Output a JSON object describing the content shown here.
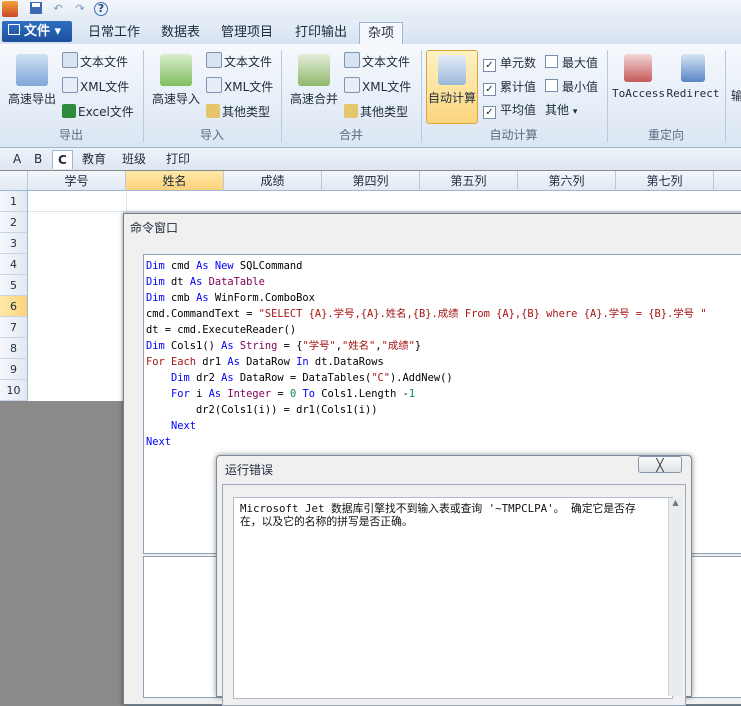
{
  "qat": {
    "icons": [
      "app-icon",
      "save-icon",
      "undo-icon",
      "redo-icon",
      "help-icon"
    ],
    "help_glyph": "?"
  },
  "file_menu": {
    "label": "文件"
  },
  "tabs": [
    "日常工作",
    "数据表",
    "管理项目",
    "打印输出",
    "杂项"
  ],
  "ribbon": {
    "export": {
      "big": "高速导出",
      "items": [
        "文本文件",
        "XML文件",
        "Excel文件"
      ],
      "label": "导出"
    },
    "import": {
      "big": "高速导入",
      "items": [
        "文本文件",
        "XML文件",
        "其他类型"
      ],
      "label": "导入"
    },
    "merge": {
      "big": "高速合并",
      "items": [
        "文本文件",
        "XML文件",
        "其他类型"
      ],
      "label": "合并"
    },
    "auto": {
      "big": "自动计算",
      "checks": [
        "单元数",
        "累计值",
        "平均值"
      ],
      "checks2": [
        "最大值",
        "最小值"
      ],
      "other": "其他",
      "label": "自动计算"
    },
    "redirect": {
      "items": [
        "ToAccess",
        "Redirect"
      ],
      "label": "重定向",
      "cut": "输"
    }
  },
  "sheet_tabs": [
    "A",
    "B",
    "C",
    "教育",
    "班级",
    "打印"
  ],
  "columns": [
    "学号",
    "姓名",
    "成绩",
    "第四列",
    "第五列",
    "第六列",
    "第七列"
  ],
  "rows": [
    "1",
    "2",
    "3",
    "4",
    "5",
    "6",
    "7",
    "8",
    "9",
    "10"
  ],
  "command_window": {
    "title": "命令窗口",
    "code": [
      "Dim cmd As New SQLCommand",
      "Dim dt As DataTable",
      "Dim cmb As WinForm.ComboBox",
      "cmd.CommandText = \"SELECT {A}.学号,{A}.姓名,{B}.成绩 From {A},{B} where {A}.学号 = {B}.学号 \"",
      "dt = cmd.ExecuteReader()",
      "Dim Cols1() As String = {\"学号\",\"姓名\",\"成绩\"}",
      "For Each dr1 As DataRow In dt.DataRows",
      "    Dim dr2 As DataRow = DataTables(\"C\").AddNew()",
      "    For i As Integer = 0 To Cols1.Length -1",
      "        dr2(Cols1(i)) = dr1(Cols1(i))",
      "    Next",
      "Next"
    ]
  },
  "error_dialog": {
    "title": "运行错误",
    "close": "╳",
    "message": "Microsoft Jet 数据库引擎找不到输入表或查询 '~TMPCLPA'。 确定它是否存在，以及它的名称的拼写是否正确。"
  },
  "colors": {
    "accent": "#1c4f9c",
    "selected": "#fcd27a",
    "keyword": "#0000ff",
    "string": "#a31515"
  }
}
